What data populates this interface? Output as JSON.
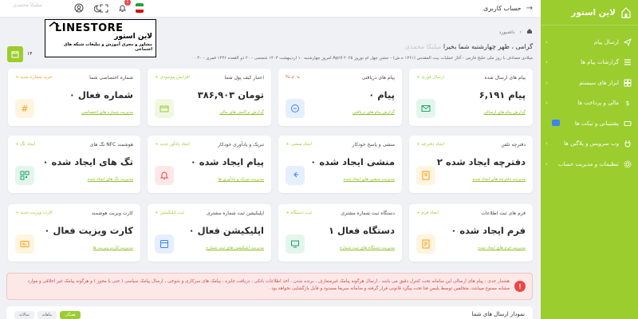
{
  "header": {
    "page_title": "حساب کاربری",
    "notif_count": "1"
  },
  "sidebar": {
    "brand": "لاین استور",
    "items": [
      {
        "label": "ارسال پیام",
        "icon": "send-icon"
      },
      {
        "label": "گزارشات پیام ها",
        "icon": "list-icon"
      },
      {
        "label": "ابزار های سیستم",
        "icon": "grid-icon"
      },
      {
        "label": "مالی و پرداخت ها",
        "icon": "dollar-icon"
      },
      {
        "label": "پشتیبانی و تیکت ها",
        "icon": "ticket-icon"
      },
      {
        "label": "وب سرویس و پلاگین ها",
        "icon": "plug-icon"
      },
      {
        "label": "تنظیمات و مدیریت حساب",
        "icon": "settings-icon"
      }
    ]
  },
  "watermark": {
    "title": "LINESTORE",
    "fa_title": "لاین استور",
    "subtitle": "مشاور و مجری آموزش و تبلیغات شبکه های اجتماعی"
  },
  "breadcrumb": {
    "home": "داشبورد"
  },
  "welcome": {
    "greeting": "گرامی ، ظهر چهارشنبه شما بخیرا",
    "name": "میلیکا محمدی",
    "date": "۰ امروز چهارشنبه ۱۰ اردیبهشت ۱۴۰۳ شمسی - ۲۰ ذو القعده ۱۴۴۶ قمری - ۳۰ April ۲۰۲۵ میلادی مصادف با روز ملی خلیج فارس - آغاز عملیات بیت المقدس (۱۳۶۱ ه.ش) - جشن چهل ام نوروز"
  },
  "calendar": {
    "year": "۱۴"
  },
  "cards": [
    {
      "title": "پیام های ارسال شده",
      "action": "+ ارسال فوری",
      "value": "۶,۱۹۱ پیام",
      "link": "گزارش پیام های ارسالی",
      "color": "#22a06b",
      "bg": "#e3f6ec",
      "icon": "mail-icon"
    },
    {
      "title": "پیام های دریافتی",
      "action": "% ↙ ↘",
      "value": "۰ پیام",
      "link": "گزارش پیام های دریافتی",
      "color": "#3b82f6",
      "bg": "#e6efff",
      "icon": "chat-icon"
    },
    {
      "title": "اعتبار کیف پول شما",
      "action": "+ افزایش موجودی",
      "value": "۳۸۶,۹۰۳ تومان",
      "link": "گزارش تراکنش های مالی",
      "color": "#9acd2d",
      "bg": "#f1f8e2",
      "icon": "wallet-icon"
    },
    {
      "title": "شماره اختصاصی شما",
      "action": "+ خرید شماره جدید",
      "value": "۰ شماره فعال",
      "link": "مدیریت شماره های اختصاصی",
      "color": "#f59e0b",
      "bg": "#fff4e0",
      "icon": "hash-icon"
    },
    {
      "title": "دفترچه تلفن",
      "action": "+ ایجاد دفترچه",
      "value": "۲ دفترچه ایجاد شده",
      "link": "مدیریت دفترچه های ایجاد شده",
      "color": "#f59e0b",
      "bg": "#fff4e0",
      "icon": "book-icon"
    },
    {
      "title": "منشی و پاسخ خودکار",
      "action": "+ ایجاد منشی",
      "value": "۰ منشی ایجاد شده",
      "link": "مدیریت منشی های ایجاد شده",
      "color": "#3b82f6",
      "bg": "#e6efff",
      "icon": "reply-icon"
    },
    {
      "title": "تبریک و یادآوری خودکار",
      "action": "+ ایجاد یادآور جدید",
      "value": "۰ پیام ایجاد شده",
      "link": "مدیریت تبریک و یادآوری ها",
      "color": "#ef4444",
      "bg": "#fde8e8",
      "icon": "bell-icon"
    },
    {
      "title": "تگ های NFC هوشمند",
      "action": "+ ایجاد تگ",
      "value": "۰ تگ های ایجاد شده",
      "link": "مدیریت تگ های ایجاد شده",
      "color": "#22a06b",
      "bg": "#e3f6ec",
      "icon": "qr-icon"
    },
    {
      "title": "فرم های ثبت اطلاعات",
      "action": "+ ایجاد فرم",
      "value": "۰ فرم ایجاد شده",
      "link": "مدیریت فرم های ایجاد شده",
      "color": "#f59e0b",
      "bg": "#fff4e0",
      "icon": "form-icon"
    },
    {
      "title": "دستگاه ثبت شماره مشتری",
      "action": "+ ثبت دستگاه",
      "value": "۱ دستگاه فعال",
      "link": "مدیریت دستگاه های ثبت شماره",
      "color": "#22a06b",
      "bg": "#e3f6ec",
      "icon": "device-icon"
    },
    {
      "title": "اپلیکیشن ثبت شماره مشتری",
      "action": "+ ثبت اپلیکیشن",
      "value": "۰ اپلیکیشن فعال",
      "link": "مدیریت اپلیکیشن های ثبت شماره",
      "color": "#3b82f6",
      "bg": "#e6efff",
      "icon": "app-icon"
    },
    {
      "title": "کارت ویزیت هوشمند",
      "action": "+ کارت ویزیت جدید",
      "value": "۰ کارت ویزیت فعال",
      "link": "مدیریت کارت ویزیت ها",
      "color": "#f59e0b",
      "bg": "#fff4e0",
      "icon": "card-icon"
    }
  ],
  "alert": {
    "text": "هشدار جدی : پیام های ارسالی این سامانه تحت کنترل دقیق می باشد ، ارسال هرگونه پیامک غیرمتعارف ، برنده شدن ، اخذ اطلاعات بانکی ، دریافت جایزه ، پیامک های سرکاری و شوخی ، ارسال پیامک سیاسی ( حتی با مجوز ) و هرگونه پیامک غیر اخلاقی و موارد مشابه ممنوع میباشد، متخلفین توسط پلیس فتا تحت پیگرد قانونی قرار گرفته و سامانه سریعا مسدود و قابل بازگشایی نخواهد بود ."
  },
  "chart": {
    "title": "نمودار ارسال های شما",
    "tabs": [
      "سالانه",
      "ماهانه",
      "هفتگی"
    ]
  }
}
